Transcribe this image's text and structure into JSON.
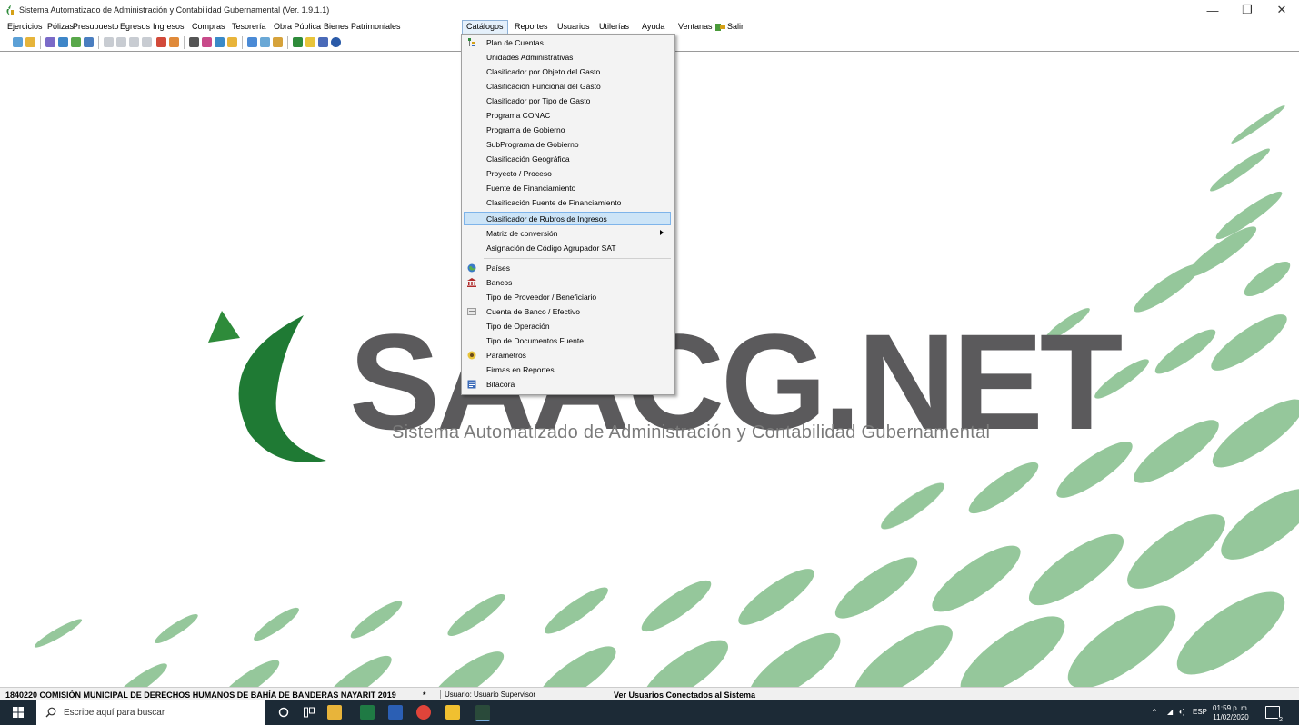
{
  "window": {
    "title": "Sistema Automatizado de Administración y Contabilidad Gubernamental  (Ver. 1.9.1.1)",
    "minimize": "—",
    "maximize": "❐",
    "close": "✕"
  },
  "menubar": {
    "items": [
      "Ejercicios",
      "Pólizas",
      "Presupuesto",
      "Egresos",
      "Ingresos",
      "Compras",
      "Tesorería",
      "Obra Pública",
      "Bienes Patrimoniales",
      "Catálogos",
      "Reportes",
      "Usuarios",
      "Utilerías",
      "Ayuda",
      "Ventanas",
      "Salir"
    ],
    "open_item": "Catálogos"
  },
  "logo": {
    "text": "SAACG.NET",
    "subtitle": "Sistema Automatizado de Administración y Contabilidad Gubernamental",
    "green": "#2e8b3a",
    "gray": "#5b5a5c"
  },
  "catalogos_menu": {
    "items": [
      {
        "label": "Plan de Cuentas",
        "icon": "tree-icon"
      },
      {
        "label": "Unidades Administrativas"
      },
      {
        "label": "Clasificador por Objeto del Gasto"
      },
      {
        "label": "Clasificación Funcional del Gasto"
      },
      {
        "label": "Clasificador por Tipo de Gasto"
      },
      {
        "label": "Programa CONAC"
      },
      {
        "label": "Programa de Gobierno"
      },
      {
        "label": "SubPrograma de Gobierno"
      },
      {
        "label": "Clasificación Geográfica"
      },
      {
        "label": "Proyecto / Proceso"
      },
      {
        "label": "Fuente de Financiamiento"
      },
      {
        "label": "Clasificación Fuente de Financiamiento"
      },
      {
        "label": "Clasificador de Rubros de Ingresos",
        "highlighted": true
      },
      {
        "label": "Matriz de conversión",
        "submenu": true
      },
      {
        "label": "Asignación de Código Agrupador SAT"
      },
      {
        "label": "Países",
        "icon": "globe-icon"
      },
      {
        "label": "Bancos",
        "icon": "bank-icon"
      },
      {
        "label": "Tipo de Proveedor / Beneficiario"
      },
      {
        "label": "Cuenta de Banco / Efectivo",
        "icon": "account-icon"
      },
      {
        "label": "Tipo de Operación"
      },
      {
        "label": "Tipo de Documentos Fuente"
      },
      {
        "label": "Parámetros",
        "icon": "parameters-icon"
      },
      {
        "label": "Firmas en Reportes"
      },
      {
        "label": "Bitácora",
        "icon": "log-icon"
      }
    ]
  },
  "statusbar": {
    "entity": "1840220 COMISIÓN MUNICIPAL DE DERECHOS HUMANOS DE BAHÍA DE BANDERAS NAYARIT  2019",
    "asterisk": "*",
    "user": "Usuario: Usuario Supervisor",
    "connected": "Ver Usuarios Conectados al Sistema"
  },
  "taskbar": {
    "search_placeholder": "Escribe aquí para buscar",
    "lang": "ESP",
    "time": "01:59 p. m.",
    "date": "11/02/2020",
    "notifications": "2"
  }
}
